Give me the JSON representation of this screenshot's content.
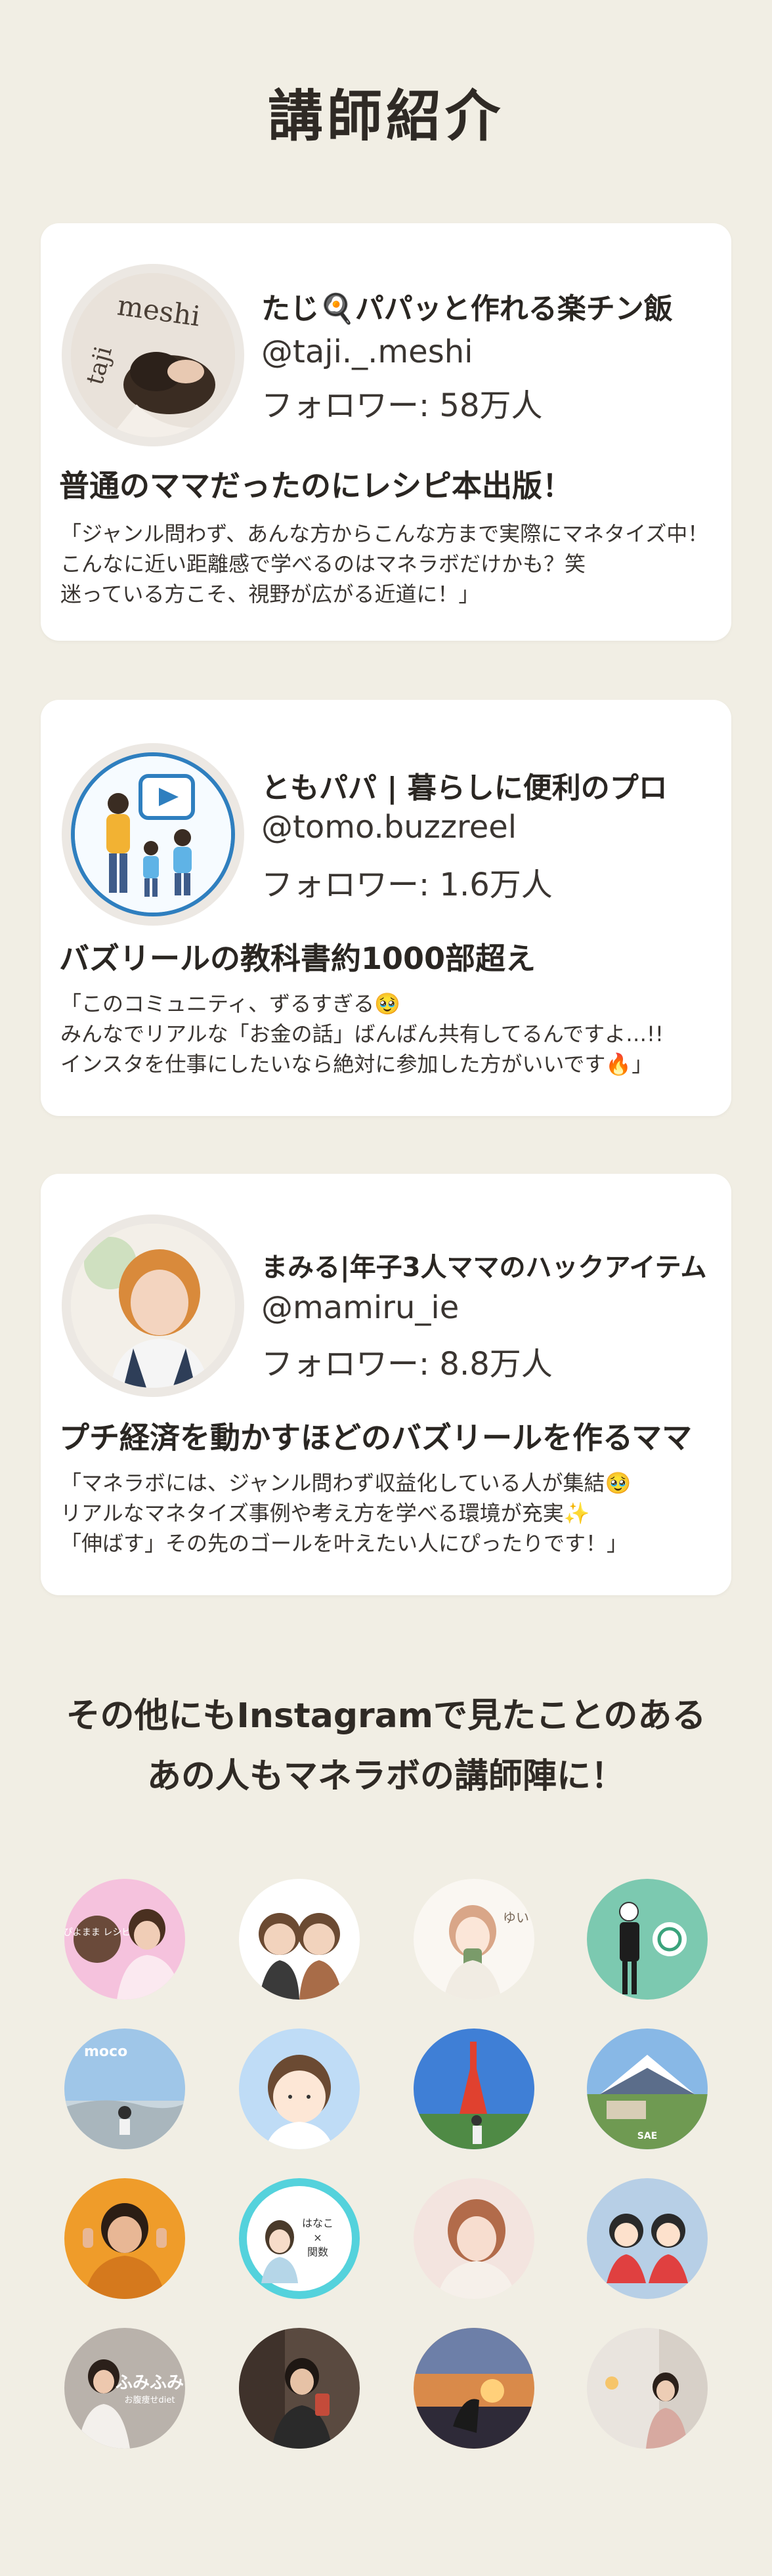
{
  "page_title": "講師紹介",
  "instructors": [
    {
      "name": "たじ🍳パパッと作れる楽チン飯",
      "handle": "@taji._.meshi",
      "followers": "フォロワー: 58万人",
      "avatar_text_1": "meshi",
      "avatar_text_2": "taji",
      "headline": "普通のママだったのにレシピ本出版！",
      "quote_lines": [
        "「ジャンル問わず、あんな方からこんな方まで実際にマネタイズ中！",
        "こんなに近い距離感で学べるのはマネラボだけかも？笑",
        "迷っている方こそ、視野が広がる近道に！」"
      ]
    },
    {
      "name": "ともパパ | 暮らしに便利のプロ",
      "handle": "@tomo.buzzreel",
      "followers": "フォロワー: 1.6万人",
      "headline": "バズリールの教科書約1000部超え",
      "quote_lines": [
        "「このコミュニティ、ずるすぎる🥹",
        "みんなでリアルな「お金の話」ばんばん共有してるんですよ…!!",
        "インスタを仕事にしたいなら絶対に参加した方がいいです🔥」"
      ]
    },
    {
      "name": "まみる|年子3人ママのハックアイテム",
      "handle": "@mamiru_ie",
      "followers": "フォロワー: 8.8万人",
      "headline": "プチ経済を動かすほどのバズリールを作るママ",
      "quote_lines": [
        "「マネラボには、ジャンル問わず収益化している人が集結🥹",
        "リアルなマネタイズ事例や考え方を学べる環境が充実✨",
        "「伸ばす」その先のゴールを叶えたい人にぴったりです！」"
      ]
    }
  ],
  "other_section": {
    "line1": "その他にもInstagramで見たことのある",
    "line2": "あの人もマネラボの講師陣に！"
  },
  "grid_avatar_texts": {
    "a1": "ぴよまま\nレシピ",
    "a3": "ゆい",
    "a5": "moco",
    "a8": "SAE",
    "a10_1": "はなこ",
    "a10_2": "×",
    "a10_3": "関数",
    "a13_1": "ふみふみ",
    "a13_2": "お腹痩せdiet"
  }
}
